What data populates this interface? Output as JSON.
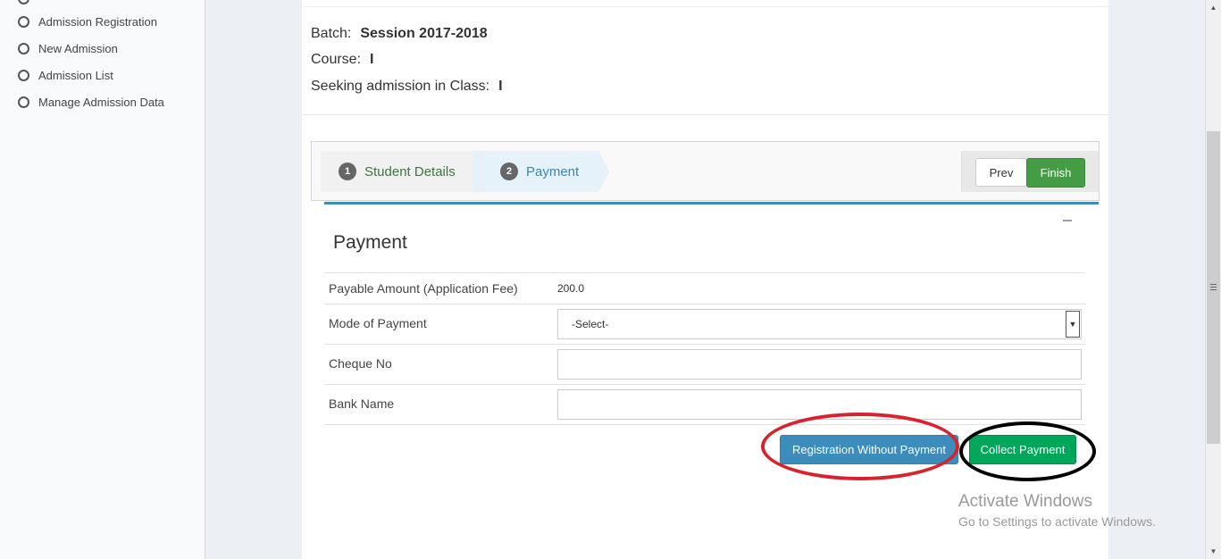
{
  "sidebar": {
    "items": [
      {
        "label": "Admission Registration"
      },
      {
        "label": "New Admission"
      },
      {
        "label": "Admission List"
      },
      {
        "label": "Manage Admission Data"
      }
    ]
  },
  "info": {
    "batch_label": "Batch:",
    "batch_value": "Session 2017-2018",
    "course_label": "Course:",
    "course_value": "I",
    "class_label": "Seeking admission in Class:",
    "class_value": "I"
  },
  "wizard": {
    "steps": [
      {
        "number": "1",
        "label": "Student Details"
      },
      {
        "number": "2",
        "label": "Payment"
      }
    ],
    "prev_label": "Prev",
    "finish_label": "Finish"
  },
  "payment": {
    "title": "Payment",
    "payable_label": "Payable Amount (Application Fee)",
    "payable_value": "200.0",
    "mode_label": "Mode of Payment",
    "mode_selected": "-Select-",
    "cheque_label": "Cheque No",
    "bank_label": "Bank Name",
    "reg_without_payment_label": "Registration Without Payment",
    "collect_payment_label": "Collect Payment"
  },
  "watermark": {
    "title": "Activate Windows",
    "subtitle": "Go to Settings to activate Windows."
  },
  "colors": {
    "primary": "#3c8dbc",
    "success": "#00a65a",
    "finish": "#449d44",
    "annotation_red": "#d8232f",
    "annotation_black": "#000000"
  }
}
